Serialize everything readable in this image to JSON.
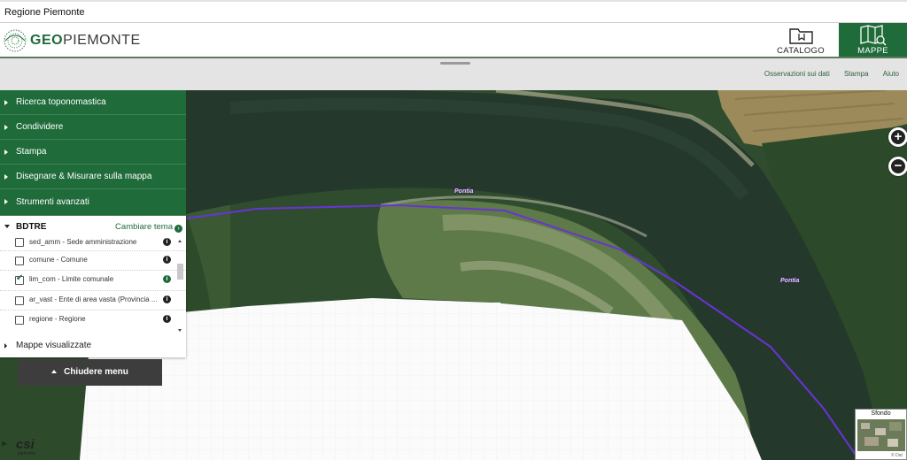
{
  "topbar": {
    "title": "Regione Piemonte"
  },
  "header": {
    "logo_text_a": "GEO",
    "logo_text_b": "PIEMONTE",
    "catalogo_label": "CATALOGO",
    "mappe_label": "MAPPE"
  },
  "toolbar_links": {
    "observations": "Osservazioni sui dati",
    "print": "Stampa",
    "help": "Aiuto"
  },
  "sidebar": {
    "items": [
      {
        "label": "Ricerca toponomastica"
      },
      {
        "label": "Condividere"
      },
      {
        "label": "Stampa"
      },
      {
        "label": "Disegnare & Misurare sulla mappa"
      },
      {
        "label": "Strumenti avanzati"
      }
    ],
    "theme": {
      "name": "BDTRE",
      "change_label": "Cambiare tema"
    },
    "layers": [
      {
        "label": "sed_amm - Sede amministrazione",
        "checked": false
      },
      {
        "label": "comune - Comune",
        "checked": false
      },
      {
        "label": "lim_com - Limite comunale",
        "checked": true
      },
      {
        "label": "ar_vast - Ente di area vasta (Provincia ...",
        "checked": false
      },
      {
        "label": "regione - Regione",
        "checked": false
      }
    ],
    "mappe_visualizzate": "Mappe visualizzate",
    "close_menu": "Chiudere menu"
  },
  "map": {
    "label_1": "Pontia",
    "label_2": "Pontia",
    "boundary_color": "#6a33d6"
  },
  "zoom": {
    "in": "+",
    "out": "−"
  },
  "basemap": {
    "title": "Sfondo",
    "credit": "© Dat"
  },
  "footer_logo": {
    "name": "csi",
    "sub": "piemonte"
  }
}
